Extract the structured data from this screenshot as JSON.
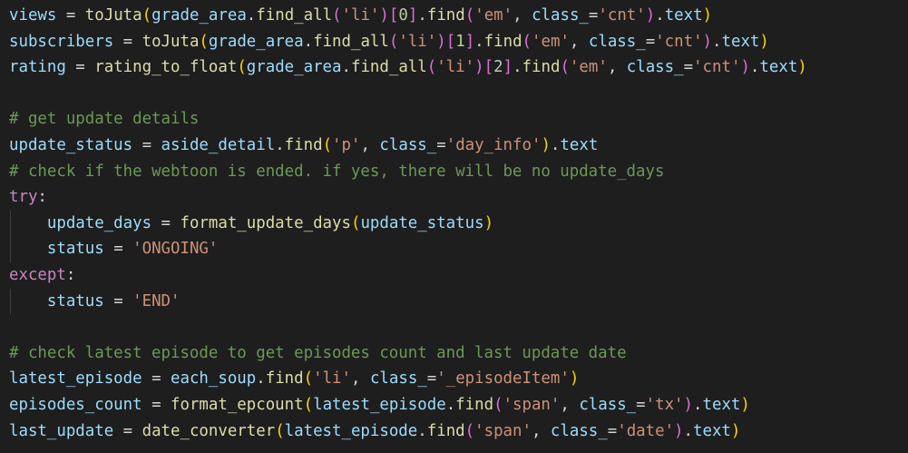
{
  "colors": {
    "background": "#1e1e1e",
    "default": "#d4d4d4",
    "variable": "#9cdcfe",
    "function": "#dcdcaa",
    "string": "#ce9178",
    "number": "#b5cea8",
    "keyword": "#c586c0",
    "comment": "#6a9955",
    "bracket_level1": "#ffd700",
    "bracket_level2": "#da70d6",
    "bracket_level3": "#179fff"
  },
  "editor": {
    "lines": [
      {
        "indent": false,
        "tokens": [
          {
            "t": "var",
            "v": "views"
          },
          {
            "t": "op",
            "v": " = "
          },
          {
            "t": "fn",
            "v": "toJuta"
          },
          {
            "t": "p1",
            "v": "("
          },
          {
            "t": "var",
            "v": "grade_area"
          },
          {
            "t": "op",
            "v": "."
          },
          {
            "t": "fn",
            "v": "find_all"
          },
          {
            "t": "p2",
            "v": "("
          },
          {
            "t": "str",
            "v": "'li'"
          },
          {
            "t": "p2",
            "v": ")"
          },
          {
            "t": "p2",
            "v": "["
          },
          {
            "t": "num",
            "v": "0"
          },
          {
            "t": "p2",
            "v": "]"
          },
          {
            "t": "op",
            "v": "."
          },
          {
            "t": "fn",
            "v": "find"
          },
          {
            "t": "p2",
            "v": "("
          },
          {
            "t": "str",
            "v": "'em'"
          },
          {
            "t": "op",
            "v": ", "
          },
          {
            "t": "var",
            "v": "class_"
          },
          {
            "t": "op",
            "v": "="
          },
          {
            "t": "str",
            "v": "'cnt'"
          },
          {
            "t": "p2",
            "v": ")"
          },
          {
            "t": "op",
            "v": "."
          },
          {
            "t": "var",
            "v": "text"
          },
          {
            "t": "p1",
            "v": ")"
          }
        ]
      },
      {
        "indent": false,
        "tokens": [
          {
            "t": "var",
            "v": "subscribers"
          },
          {
            "t": "op",
            "v": " = "
          },
          {
            "t": "fn",
            "v": "toJuta"
          },
          {
            "t": "p1",
            "v": "("
          },
          {
            "t": "var",
            "v": "grade_area"
          },
          {
            "t": "op",
            "v": "."
          },
          {
            "t": "fn",
            "v": "find_all"
          },
          {
            "t": "p2",
            "v": "("
          },
          {
            "t": "str",
            "v": "'li'"
          },
          {
            "t": "p2",
            "v": ")"
          },
          {
            "t": "p2",
            "v": "["
          },
          {
            "t": "num",
            "v": "1"
          },
          {
            "t": "p2",
            "v": "]"
          },
          {
            "t": "op",
            "v": "."
          },
          {
            "t": "fn",
            "v": "find"
          },
          {
            "t": "p2",
            "v": "("
          },
          {
            "t": "str",
            "v": "'em'"
          },
          {
            "t": "op",
            "v": ", "
          },
          {
            "t": "var",
            "v": "class_"
          },
          {
            "t": "op",
            "v": "="
          },
          {
            "t": "str",
            "v": "'cnt'"
          },
          {
            "t": "p2",
            "v": ")"
          },
          {
            "t": "op",
            "v": "."
          },
          {
            "t": "var",
            "v": "text"
          },
          {
            "t": "p1",
            "v": ")"
          }
        ]
      },
      {
        "indent": false,
        "tokens": [
          {
            "t": "var",
            "v": "rating"
          },
          {
            "t": "op",
            "v": " = "
          },
          {
            "t": "fn",
            "v": "rating_to_float"
          },
          {
            "t": "p1",
            "v": "("
          },
          {
            "t": "var",
            "v": "grade_area"
          },
          {
            "t": "op",
            "v": "."
          },
          {
            "t": "fn",
            "v": "find_all"
          },
          {
            "t": "p2",
            "v": "("
          },
          {
            "t": "str",
            "v": "'li'"
          },
          {
            "t": "p2",
            "v": ")"
          },
          {
            "t": "p2",
            "v": "["
          },
          {
            "t": "num",
            "v": "2"
          },
          {
            "t": "p2",
            "v": "]"
          },
          {
            "t": "op",
            "v": "."
          },
          {
            "t": "fn",
            "v": "find"
          },
          {
            "t": "p2",
            "v": "("
          },
          {
            "t": "str",
            "v": "'em'"
          },
          {
            "t": "op",
            "v": ", "
          },
          {
            "t": "var",
            "v": "class_"
          },
          {
            "t": "op",
            "v": "="
          },
          {
            "t": "str",
            "v": "'cnt'"
          },
          {
            "t": "p2",
            "v": ")"
          },
          {
            "t": "op",
            "v": "."
          },
          {
            "t": "var",
            "v": "text"
          },
          {
            "t": "p1",
            "v": ")"
          }
        ]
      },
      {
        "indent": false,
        "tokens": []
      },
      {
        "indent": false,
        "tokens": [
          {
            "t": "cm",
            "v": "# get update details"
          }
        ]
      },
      {
        "indent": false,
        "tokens": [
          {
            "t": "var",
            "v": "update_status"
          },
          {
            "t": "op",
            "v": " = "
          },
          {
            "t": "var",
            "v": "aside_detail"
          },
          {
            "t": "op",
            "v": "."
          },
          {
            "t": "fn",
            "v": "find"
          },
          {
            "t": "p1",
            "v": "("
          },
          {
            "t": "str",
            "v": "'p'"
          },
          {
            "t": "op",
            "v": ", "
          },
          {
            "t": "var",
            "v": "class_"
          },
          {
            "t": "op",
            "v": "="
          },
          {
            "t": "str",
            "v": "'day_info'"
          },
          {
            "t": "p1",
            "v": ")"
          },
          {
            "t": "op",
            "v": "."
          },
          {
            "t": "var",
            "v": "text"
          }
        ]
      },
      {
        "indent": false,
        "tokens": [
          {
            "t": "cm",
            "v": "# check if the webtoon is ended. if yes, there will be no update_days"
          }
        ]
      },
      {
        "indent": false,
        "tokens": [
          {
            "t": "kw",
            "v": "try"
          },
          {
            "t": "op",
            "v": ":"
          }
        ]
      },
      {
        "indent": true,
        "tokens": [
          {
            "t": "op",
            "v": "    "
          },
          {
            "t": "var",
            "v": "update_days"
          },
          {
            "t": "op",
            "v": " = "
          },
          {
            "t": "fn",
            "v": "format_update_days"
          },
          {
            "t": "p1",
            "v": "("
          },
          {
            "t": "var",
            "v": "update_status"
          },
          {
            "t": "p1",
            "v": ")"
          }
        ]
      },
      {
        "indent": true,
        "tokens": [
          {
            "t": "op",
            "v": "    "
          },
          {
            "t": "var",
            "v": "status"
          },
          {
            "t": "op",
            "v": " = "
          },
          {
            "t": "str",
            "v": "'ONGOING'"
          }
        ]
      },
      {
        "indent": false,
        "tokens": [
          {
            "t": "kw",
            "v": "except"
          },
          {
            "t": "op",
            "v": ":"
          }
        ]
      },
      {
        "indent": true,
        "tokens": [
          {
            "t": "op",
            "v": "    "
          },
          {
            "t": "var",
            "v": "status"
          },
          {
            "t": "op",
            "v": " = "
          },
          {
            "t": "str",
            "v": "'END'"
          }
        ]
      },
      {
        "indent": false,
        "tokens": []
      },
      {
        "indent": false,
        "tokens": [
          {
            "t": "cm",
            "v": "# check latest episode to get episodes count and last update date"
          }
        ]
      },
      {
        "indent": false,
        "tokens": [
          {
            "t": "var",
            "v": "latest_episode"
          },
          {
            "t": "op",
            "v": " = "
          },
          {
            "t": "var",
            "v": "each_soup"
          },
          {
            "t": "op",
            "v": "."
          },
          {
            "t": "fn",
            "v": "find"
          },
          {
            "t": "p1",
            "v": "("
          },
          {
            "t": "str",
            "v": "'li'"
          },
          {
            "t": "op",
            "v": ", "
          },
          {
            "t": "var",
            "v": "class_"
          },
          {
            "t": "op",
            "v": "="
          },
          {
            "t": "str",
            "v": "'_episodeItem'"
          },
          {
            "t": "p1",
            "v": ")"
          }
        ]
      },
      {
        "indent": false,
        "tokens": [
          {
            "t": "var",
            "v": "episodes_count"
          },
          {
            "t": "op",
            "v": " = "
          },
          {
            "t": "fn",
            "v": "format_epcount"
          },
          {
            "t": "p1",
            "v": "("
          },
          {
            "t": "var",
            "v": "latest_episode"
          },
          {
            "t": "op",
            "v": "."
          },
          {
            "t": "fn",
            "v": "find"
          },
          {
            "t": "p2",
            "v": "("
          },
          {
            "t": "str",
            "v": "'span'"
          },
          {
            "t": "op",
            "v": ", "
          },
          {
            "t": "var",
            "v": "class_"
          },
          {
            "t": "op",
            "v": "="
          },
          {
            "t": "str",
            "v": "'tx'"
          },
          {
            "t": "p2",
            "v": ")"
          },
          {
            "t": "op",
            "v": "."
          },
          {
            "t": "var",
            "v": "text"
          },
          {
            "t": "p1",
            "v": ")"
          }
        ]
      },
      {
        "indent": false,
        "tokens": [
          {
            "t": "var",
            "v": "last_update"
          },
          {
            "t": "op",
            "v": " = "
          },
          {
            "t": "fn",
            "v": "date_converter"
          },
          {
            "t": "p1",
            "v": "("
          },
          {
            "t": "var",
            "v": "latest_episode"
          },
          {
            "t": "op",
            "v": "."
          },
          {
            "t": "fn",
            "v": "find"
          },
          {
            "t": "p2",
            "v": "("
          },
          {
            "t": "str",
            "v": "'span'"
          },
          {
            "t": "op",
            "v": ", "
          },
          {
            "t": "var",
            "v": "class_"
          },
          {
            "t": "op",
            "v": "="
          },
          {
            "t": "str",
            "v": "'date'"
          },
          {
            "t": "p2",
            "v": ")"
          },
          {
            "t": "op",
            "v": "."
          },
          {
            "t": "var",
            "v": "text"
          },
          {
            "t": "p1",
            "v": ")"
          }
        ]
      }
    ]
  }
}
